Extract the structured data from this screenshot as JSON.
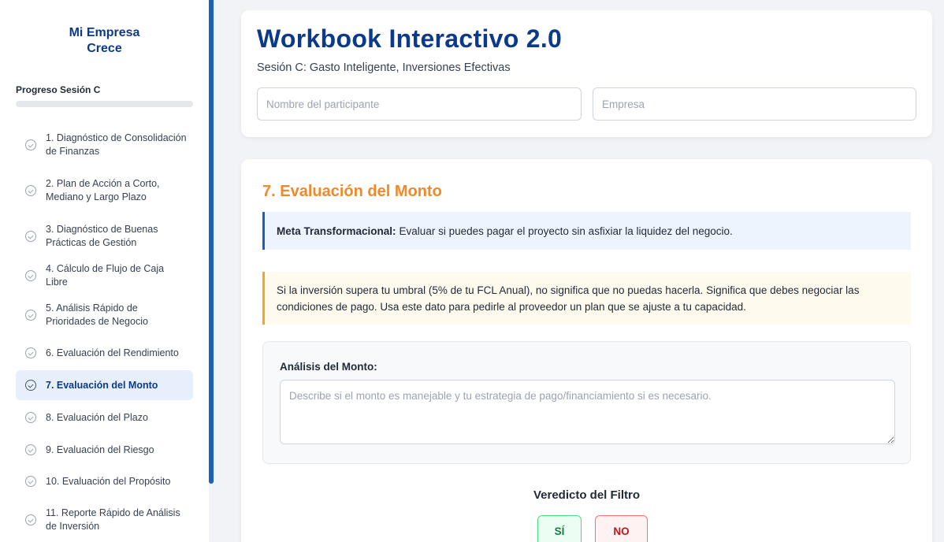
{
  "sidebar": {
    "brand_line1": "Mi Empresa",
    "brand_line2": "Crece",
    "progress_label": "Progreso Sesión C",
    "progress_fraction": 0,
    "items": [
      {
        "label": "1. Diagnóstico de Consolidación de Finanzas",
        "active": false
      },
      {
        "label": "2. Plan de Acción a Corto, Mediano y Largo Plazo",
        "active": false
      },
      {
        "label": "3. Diagnóstico de Buenas Prácticas de Gestión",
        "active": false
      },
      {
        "label": "4. Cálculo de Flujo de Caja Libre",
        "active": false
      },
      {
        "label": "5. Análisis Rápido de Prioridades de Negocio",
        "active": false
      },
      {
        "label": "6. Evaluación del Rendimiento",
        "active": false
      },
      {
        "label": "7. Evaluación del Monto",
        "active": true
      },
      {
        "label": "8. Evaluación del Plazo",
        "active": false
      },
      {
        "label": "9. Evaluación del Riesgo",
        "active": false
      },
      {
        "label": "10. Evaluación del Propósito",
        "active": false
      },
      {
        "label": "11. Reporte Rápido de Análisis de Inversión",
        "active": false
      }
    ],
    "item_icon": "check-circle-icon"
  },
  "header": {
    "title": "Workbook Interactivo 2.0",
    "subtitle": "Sesión C: Gasto Inteligente, Inversiones Efectivas",
    "participant_placeholder": "Nombre del participante",
    "participant_value": "",
    "company_placeholder": "Empresa",
    "company_value": ""
  },
  "section": {
    "title": "7. Evaluación del Monto",
    "meta_label": "Meta Transformacional:",
    "meta_text": "Evaluar si puedes pagar el proyecto sin asfixiar la liquidez del negocio.",
    "warning_text": "Si la inversión supera tu umbral (5% de tu FCL Anual), no significa que no puedas hacerla. Significa que debes negociar las condiciones de pago. Usa este dato para pedirle al proveedor un plan que se ajuste a tu capacidad.",
    "analysis_label": "Análisis del Monto:",
    "analysis_placeholder": "Describe si el monto es manejable y tu estrategia de pago/financiamiento si es necesario.",
    "analysis_value": "",
    "verdict_title": "Veredicto del Filtro",
    "yes_label": "SÍ",
    "no_label": "NO"
  },
  "colors": {
    "brand_blue": "#0b3a8a",
    "accent_blue": "#1d5fbf",
    "section_orange": "#f0892a",
    "warning_border": "#f5a524",
    "yes_green": "#15803d",
    "no_red": "#b91c1c"
  }
}
